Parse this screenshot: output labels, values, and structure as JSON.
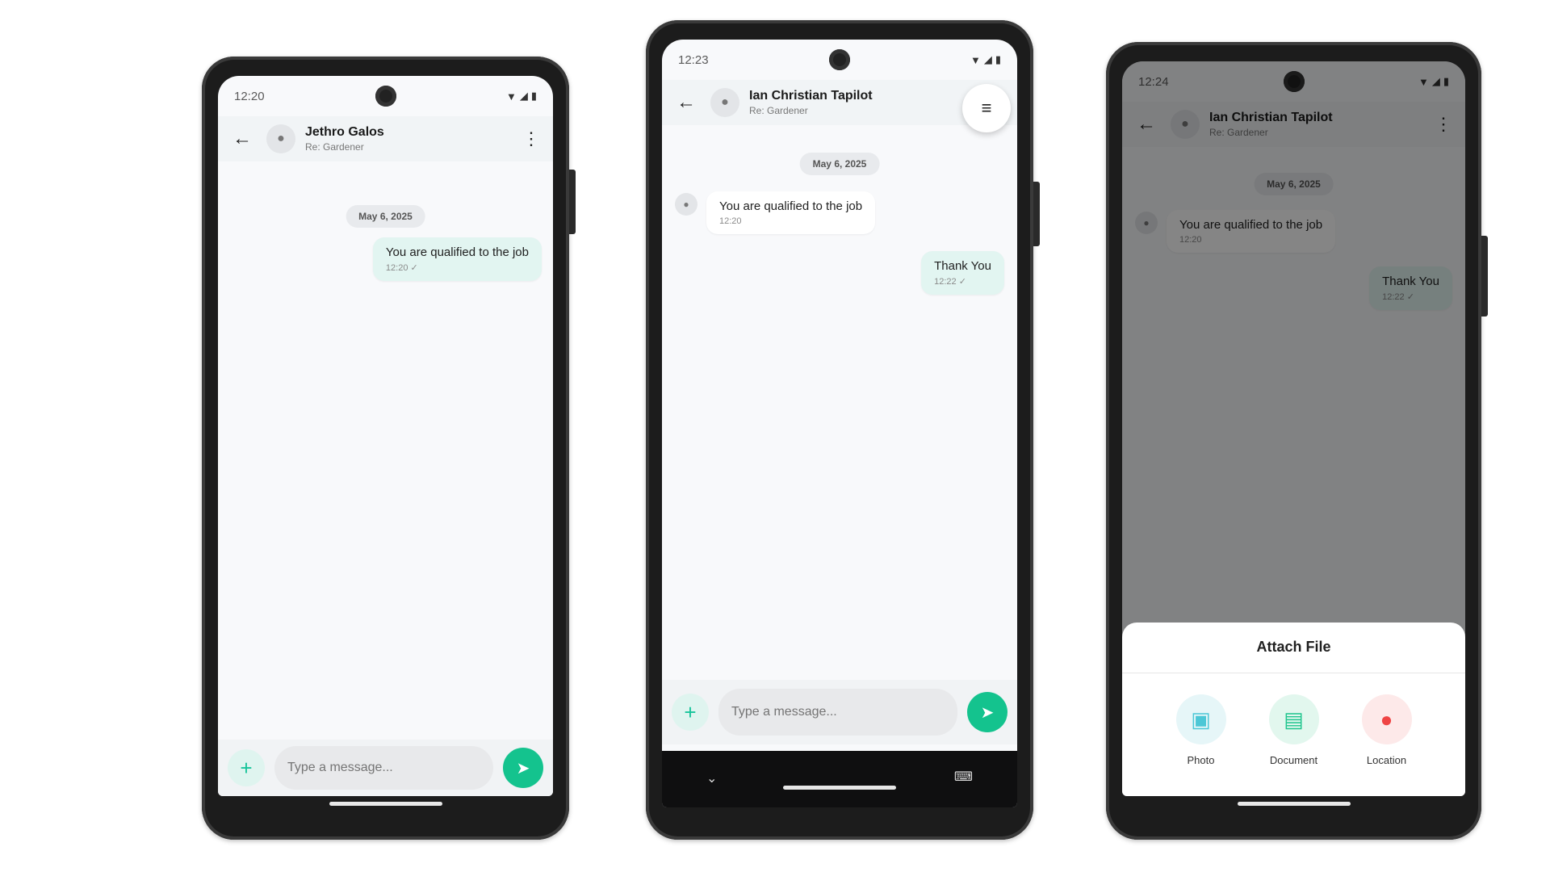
{
  "screens": [
    {
      "status_time": "12:20",
      "contact_name": "Jethro Galos",
      "contact_sub": "Re: Gardener",
      "date_chip": "May 6, 2025",
      "messages": [
        {
          "text": "You are qualified to the job",
          "time": "12:20",
          "direction": "out",
          "status": "✓"
        }
      ],
      "input_placeholder": "Type a message..."
    },
    {
      "status_time": "12:23",
      "contact_name": "Ian Christian Tapilot",
      "contact_sub": "Re: Gardener",
      "date_chip": "May 6, 2025",
      "messages": [
        {
          "text": "You are qualified to the job",
          "time": "12:20",
          "direction": "in"
        },
        {
          "text": "Thank You",
          "time": "12:22",
          "direction": "out",
          "status": "✓"
        }
      ],
      "input_placeholder": "Type a message..."
    },
    {
      "status_time": "12:24",
      "contact_name": "Ian Christian Tapilot",
      "contact_sub": "Re: Gardener",
      "date_chip": "May 6, 2025",
      "messages": [
        {
          "text": "You are qualified to the job",
          "time": "12:20",
          "direction": "in"
        },
        {
          "text": "Thank You",
          "time": "12:22",
          "direction": "out",
          "status": "✓"
        }
      ],
      "sheet": {
        "title": "Attach File",
        "options": [
          {
            "label": "Photo",
            "icon": "image-icon",
            "bg": "#e6f6f8",
            "fg": "#4cc7d6"
          },
          {
            "label": "Document",
            "icon": "document-icon",
            "bg": "#e2f7ee",
            "fg": "#1fc58e"
          },
          {
            "label": "Location",
            "icon": "location-pin-icon",
            "bg": "#fde9e9",
            "fg": "#ef4444"
          }
        ]
      }
    }
  ],
  "colors": {
    "accent": "#14c38e",
    "bubble_out": "#e2f5f1",
    "appbar": "#f1f4f6"
  }
}
